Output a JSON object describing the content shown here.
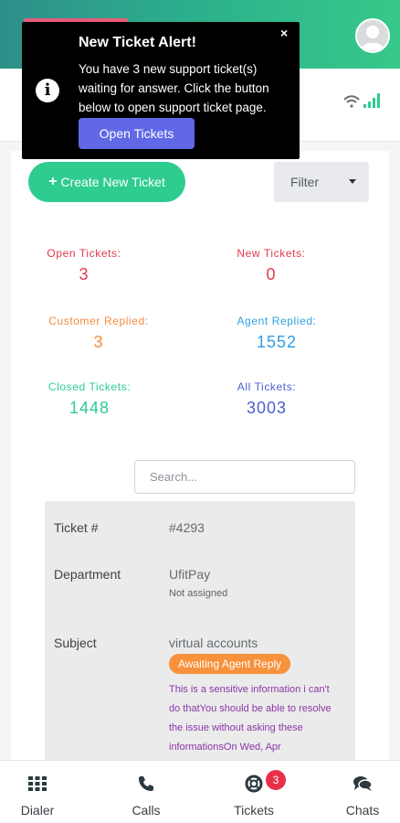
{
  "alert": {
    "title": "New Ticket Alert!",
    "body": "You have 3 new support ticket(s) waiting for answer. Click the button below to open support ticket page.",
    "button": "Open Tickets",
    "close": "×",
    "info_glyph": "i"
  },
  "toolbar": {
    "create_label": "Create New Ticket",
    "create_icon": "+",
    "filter_label": "Filter"
  },
  "stats": {
    "open": {
      "label": "Open Tickets:",
      "value": "3",
      "color": "#e23a4e"
    },
    "new": {
      "label": "New Tickets:",
      "value": "0",
      "color": "#e23a4e"
    },
    "customer_replied": {
      "label": "Customer Replied:",
      "value": "3",
      "color": "#f58a3c"
    },
    "agent_replied": {
      "label": "Agent Replied:",
      "value": "1552",
      "color": "#2f9fe0"
    },
    "closed": {
      "label": "Closed Tickets:",
      "value": "1448",
      "color": "#2ecc8f"
    },
    "all": {
      "label": "All Tickets:",
      "value": "3003",
      "color": "#4a5fd0"
    }
  },
  "search": {
    "placeholder": "Search..."
  },
  "ticket": {
    "number_label": "Ticket #",
    "number": "#4293",
    "department_label": "Department",
    "department": "UfitPay",
    "assignee": "Not assigned",
    "subject_label": "Subject",
    "subject": "virtual accounts",
    "status": "Awaiting Agent Reply",
    "message": "This is a sensitive information i can't do thatYou should be able to resolve the issue without asking these informationsOn Wed, Apr"
  },
  "nav": {
    "dialer": "Dialer",
    "calls": "Calls",
    "tickets": "Tickets",
    "tickets_badge": "3",
    "chats": "Chats"
  },
  "colors": {
    "accent": "#2ecc8f",
    "alert_button": "#6168e6",
    "status_badge": "#f7913c",
    "nav_badge": "#e8304a"
  }
}
